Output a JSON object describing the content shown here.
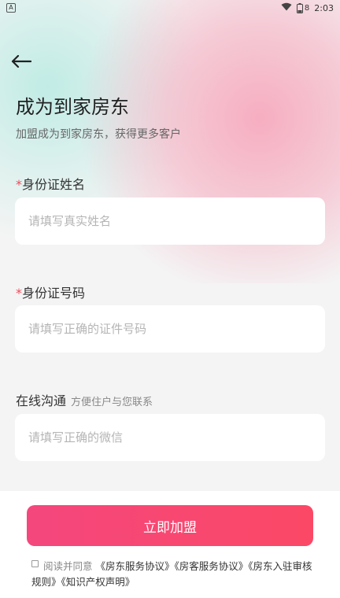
{
  "status_bar": {
    "app_icon_letter": "A",
    "battery_level": "8",
    "time": "2:03"
  },
  "header": {
    "title": "成为到家房东",
    "subtitle": "加盟成为到家房东，获得更多客户"
  },
  "form": {
    "name": {
      "required_mark": "*",
      "label": "身份证姓名",
      "placeholder": "请填写真实姓名",
      "value": ""
    },
    "id_number": {
      "required_mark": "*",
      "label": "身份证号码",
      "placeholder": "请填写正确的证件号码",
      "value": ""
    },
    "wechat": {
      "label": "在线沟通",
      "hint": "方便住户与您联系",
      "placeholder": "请填写正确的微信",
      "value": ""
    }
  },
  "actions": {
    "join_label": "立即加盟"
  },
  "agreement": {
    "checked": false,
    "prefix": "阅读并同意",
    "links": [
      "《房东服务协议》",
      "《房客服务协议》",
      "《房东入驻审核规则》",
      "《知识产权声明》"
    ]
  },
  "colors": {
    "accent": "#f4477d",
    "required": "#f04b5b"
  },
  "icons": {
    "back": "arrow-left-icon",
    "wifi": "wifi-icon",
    "battery": "battery-icon"
  }
}
